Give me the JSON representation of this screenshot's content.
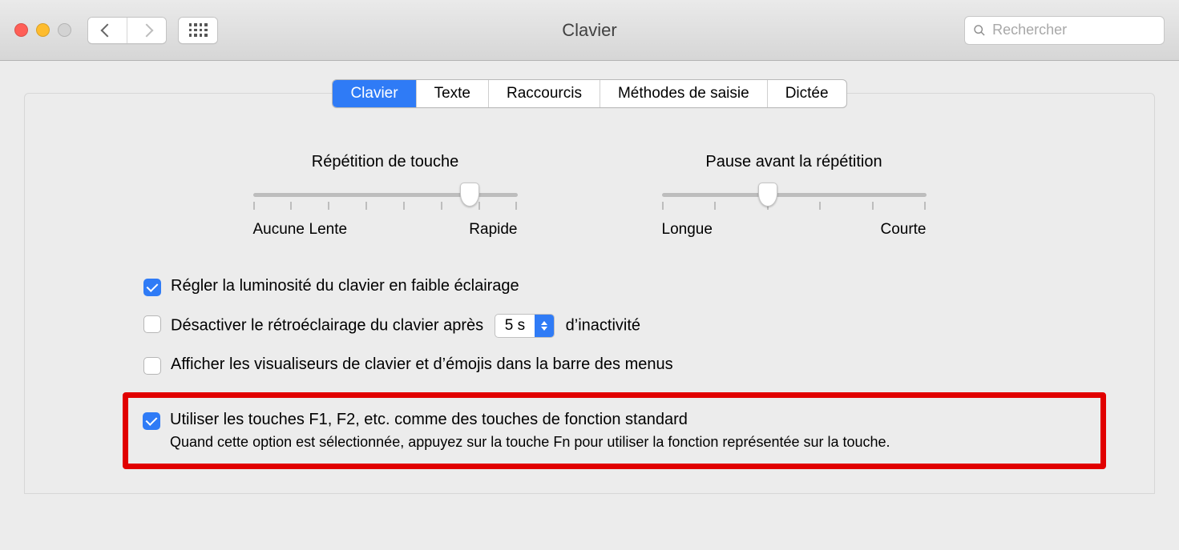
{
  "window": {
    "title": "Clavier"
  },
  "search": {
    "placeholder": "Rechercher"
  },
  "tabs": {
    "clavier": "Clavier",
    "texte": "Texte",
    "raccourcis": "Raccourcis",
    "methodes": "Méthodes de saisie",
    "dictee": "Dictée"
  },
  "sliders": {
    "repeat": {
      "title": "Répétition de touche",
      "left": "Aucune",
      "mid": "Lente",
      "right": "Rapide"
    },
    "delay": {
      "title": "Pause avant la répétition",
      "left": "Longue",
      "right": "Courte"
    }
  },
  "options": {
    "brightness": "Régler la luminosité du clavier en faible éclairage",
    "backlight_off_prefix": "Désactiver le rétroéclairage du clavier après",
    "backlight_off_value": "5 s",
    "backlight_off_suffix": "d’inactivité",
    "viewers": "Afficher les visualiseurs de clavier et d’émojis dans la barre des menus",
    "fn_keys": "Utiliser les touches F1, F2, etc. comme des touches de fonction standard",
    "fn_keys_sub": "Quand cette option est sélectionnée, appuyez sur la touche Fn pour utiliser la fonction représentée sur la touche."
  }
}
